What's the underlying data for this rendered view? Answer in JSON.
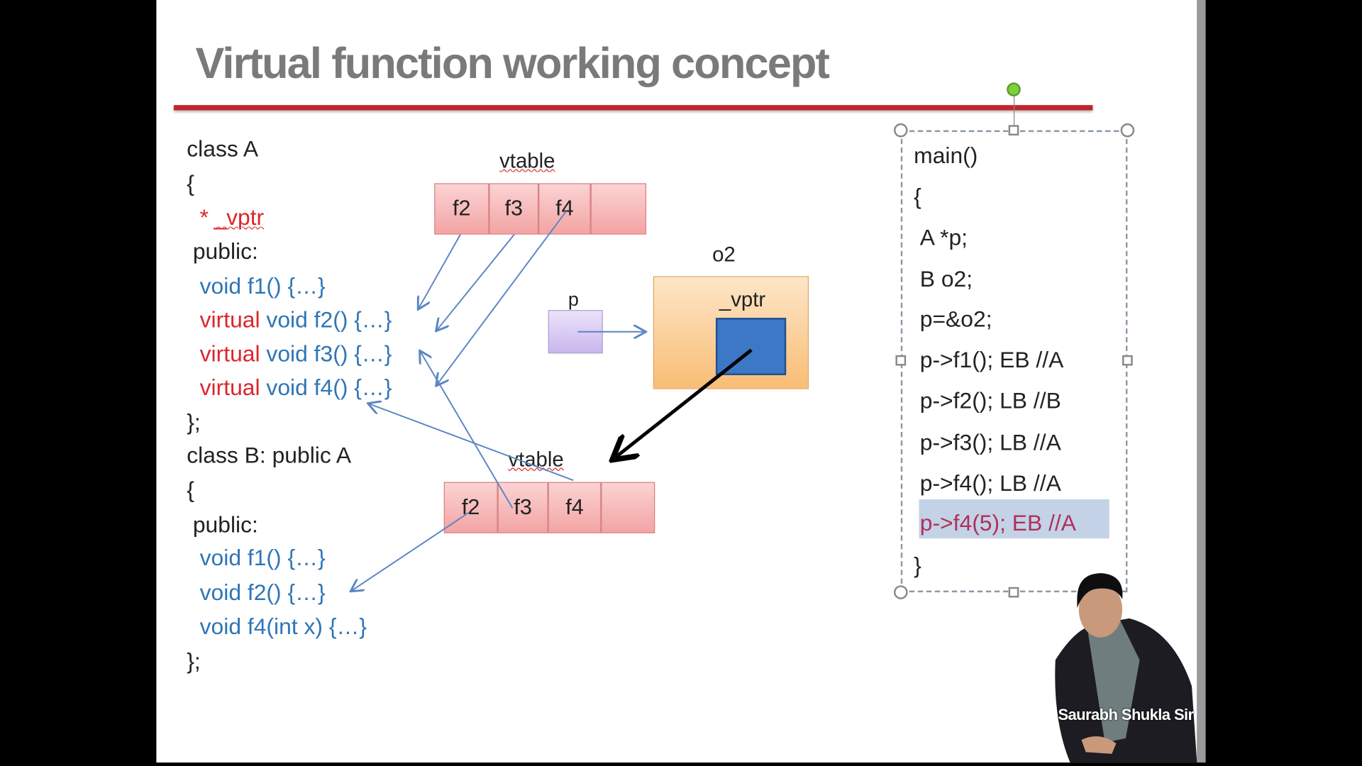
{
  "title": "Virtual function working concept",
  "class_a": {
    "lines": [
      "class A",
      "{",
      "*",
      "_vptr",
      "public:",
      "void f1() {…}",
      "virtual",
      "void f2() {…}",
      "virtual",
      "void f3() {…}",
      "virtual",
      "void f4() {…}",
      "};"
    ]
  },
  "class_b": {
    "lines": [
      "class B: public A",
      "{",
      "public:",
      "void f1() {…}",
      "void f2() {…}",
      "void f4(int x) {…}",
      "};"
    ]
  },
  "vtable_a": {
    "label": "vtable",
    "cells": [
      "f2",
      "f3",
      "f4",
      ""
    ]
  },
  "vtable_b": {
    "label": "vtable",
    "cells": [
      "f2",
      "f3",
      "f4",
      ""
    ]
  },
  "pointer": {
    "label": "p"
  },
  "object": {
    "label": "o2",
    "vptr_label": "_vptr"
  },
  "main_box": {
    "lines": [
      "main()",
      "{",
      "A *p;",
      "B o2;",
      "p=&o2;",
      "p->f1(); EB //A",
      "p->f2(); LB //B",
      "p->f3(); LB //A",
      "p->f4(); LB //A",
      "p->f4(5); EB //A",
      "}"
    ],
    "highlighted_index": 9
  },
  "presenter": {
    "caption": "Saurabh Shukla Sir"
  },
  "colors": {
    "title": "#7a7a7a",
    "rule": "#c0262b",
    "keyword": "#d9262e",
    "code": "#2e75b6",
    "highlight": "#c3d2e6"
  }
}
